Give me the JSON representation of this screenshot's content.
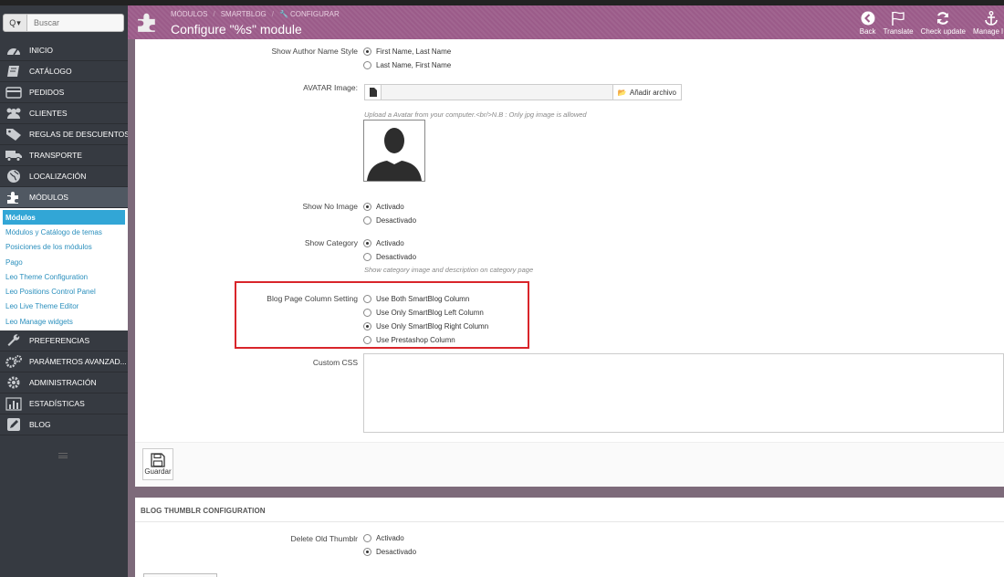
{
  "search": {
    "button_label": "Q",
    "placeholder": "Buscar"
  },
  "sidebar": {
    "items": [
      {
        "label": "INICIO",
        "icon": "dashboard-icon"
      },
      {
        "label": "CATÁLOGO",
        "icon": "book-icon"
      },
      {
        "label": "PEDIDOS",
        "icon": "credit-card-icon"
      },
      {
        "label": "CLIENTES",
        "icon": "users-icon"
      },
      {
        "label": "REGLAS DE DESCUENTOS",
        "icon": "tag-icon"
      },
      {
        "label": "TRANSPORTE",
        "icon": "truck-icon"
      },
      {
        "label": "LOCALIZACIÓN",
        "icon": "globe-icon"
      },
      {
        "label": "MÓDULOS",
        "icon": "puzzle-icon"
      }
    ],
    "submenu": [
      "Módulos",
      "Módulos y Catálogo de temas",
      "Posiciones de los módulos",
      "Pago",
      "Leo Theme Configuration",
      "Leo Positions Control Panel",
      "Leo Live Theme Editor",
      "Leo Manage widgets"
    ],
    "items_after": [
      {
        "label": "PREFERENCIAS",
        "icon": "wrench-icon"
      },
      {
        "label": "PARÁMETROS AVANZAD...",
        "icon": "gears-icon"
      },
      {
        "label": "ADMINISTRACIÓN",
        "icon": "cog-icon"
      },
      {
        "label": "ESTADÍSTICAS",
        "icon": "bar-chart-icon"
      },
      {
        "label": "BLOG",
        "icon": "pencil-icon"
      }
    ]
  },
  "header": {
    "breadcrumb": [
      "MÓDULOS",
      "SMARTBLOG",
      "CONFIGURAR"
    ],
    "title": "Configure \"%s\" module",
    "toolbar": [
      "Back",
      "Translate",
      "Check update",
      "Manage l"
    ]
  },
  "form": {
    "author_style": {
      "label": "Show Author Name Style",
      "options": [
        "First Name, Last Name",
        "Last Name, First Name"
      ],
      "selected": 0
    },
    "avatar": {
      "label": "AVATAR Image:",
      "button": "Añadir archivo",
      "help": "Upload a Avatar from your computer.<br/>N.B : Only jpg image is allowed"
    },
    "no_image": {
      "label": "Show No Image",
      "options": [
        "Activado",
        "Desactivado"
      ],
      "selected": 0
    },
    "category": {
      "label": "Show Category",
      "options": [
        "Activado",
        "Desactivado"
      ],
      "selected": 0,
      "help": "Show category image and description on category page"
    },
    "column_setting": {
      "label": "Blog Page Column Setting",
      "options": [
        "Use Both SmartBlog Column",
        "Use Only SmartBlog Left Column",
        "Use Only SmartBlog Right Column",
        "Use Prestashop Column"
      ],
      "selected": 2
    },
    "custom_css": {
      "label": "Custom CSS"
    },
    "save_label": "Guardar"
  },
  "thumb": {
    "heading": "BLOG THUMBLR CONFIGURATION",
    "delete_old": {
      "label": "Delete Old Thumblr",
      "options": [
        "Activado",
        "Desactivado"
      ],
      "selected": 1
    }
  }
}
